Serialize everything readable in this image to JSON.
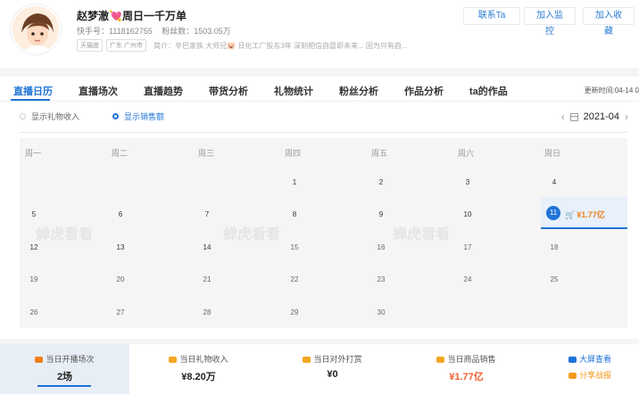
{
  "profile": {
    "name": "赵梦澈💘周日一千万单",
    "kuaishou_id": "快手号：1118162755",
    "fans": "粉丝数：1503.05万",
    "tag_verified": "天猫度",
    "tag_location": "广东 广州市",
    "intro": "简介：辛巴家族 大师兄🐷 日化工厂股东3年 深刻相信自冒即未来... 因为只有自...",
    "btn_contact": "联系Ta",
    "btn_monitor": "加入监控",
    "btn_collect": "加入收藏"
  },
  "tabs": [
    "直播日历",
    "直播场次",
    "直播趋势",
    "带货分析",
    "礼物统计",
    "粉丝分析",
    "作品分析",
    "ta的作品"
  ],
  "updated": "更新时间:04-14 0",
  "filters": {
    "gift_income": "显示礼物收入",
    "sales": "显示销售额"
  },
  "month": "2021-04",
  "weekdays": [
    "周一",
    "周二",
    "周三",
    "周四",
    "周五",
    "周六",
    "周日"
  ],
  "weeks": [
    [
      "",
      "",
      "",
      "1",
      "2",
      "3",
      "4"
    ],
    [
      "5",
      "6",
      "7",
      "8",
      "9",
      "10",
      "11"
    ],
    [
      "12",
      "13",
      "14",
      "15",
      "16",
      "17",
      "18"
    ],
    [
      "19",
      "20",
      "21",
      "22",
      "23",
      "24",
      "25"
    ],
    [
      "26",
      "27",
      "28",
      "29",
      "30",
      "",
      ""
    ]
  ],
  "selected": {
    "day": "11",
    "amount": "¥1.77亿"
  },
  "watermark": "蝉虎看看",
  "stats": [
    {
      "label": "当日开播场次",
      "value": "2场"
    },
    {
      "label": "当日礼物收入",
      "value": "¥8.20万"
    },
    {
      "label": "当日对外打赏",
      "value": "¥0"
    },
    {
      "label": "当日商品销售",
      "value": "¥1.77亿"
    }
  ],
  "links": {
    "big_screen": "大屏查看",
    "share": "分享战报"
  },
  "colors": {
    "accent": "#1f73d6",
    "orange": "#f35d2b",
    "gold": "#f5a623"
  }
}
